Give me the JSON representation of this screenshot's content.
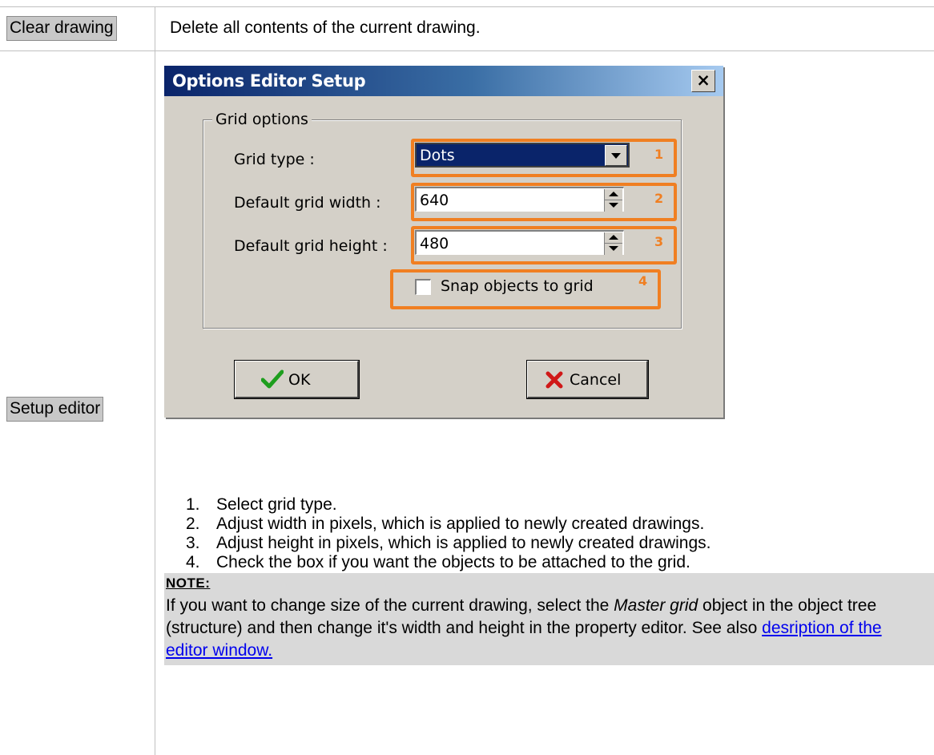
{
  "rows": [
    {
      "label": "Clear drawing",
      "description": "Delete all contents of the current drawing."
    },
    {
      "label": "Setup editor"
    }
  ],
  "dialog": {
    "title": "Options Editor Setup",
    "close_glyph": "×",
    "group_title": "Grid options",
    "grid_type_label": "Grid type :",
    "grid_type_value": "Dots",
    "grid_width_label": "Default grid width :",
    "grid_width_value": "640",
    "grid_height_label": "Default grid height :",
    "grid_height_value": "480",
    "snap_label": "Snap objects to grid",
    "snap_checked": false,
    "ok_label": "OK",
    "cancel_label": "Cancel",
    "callouts": [
      "1",
      "2",
      "3",
      "4"
    ],
    "highlight_color": "#f07f22"
  },
  "steps": [
    "Select grid type.",
    "Adjust width in pixels, which is applied to newly created drawings.",
    "Adjust height in pixels, which is applied to newly created drawings.",
    "Check the box if you want the objects to be attached to the grid."
  ],
  "note": {
    "title": "NOTE:",
    "text_before": "If you want to change size of the current drawing, select the ",
    "emphasis": "Master grid",
    "text_after": " object in the object tree (structure) and then change it's width and height in the property editor. See also ",
    "link": "desription of the editor window."
  }
}
